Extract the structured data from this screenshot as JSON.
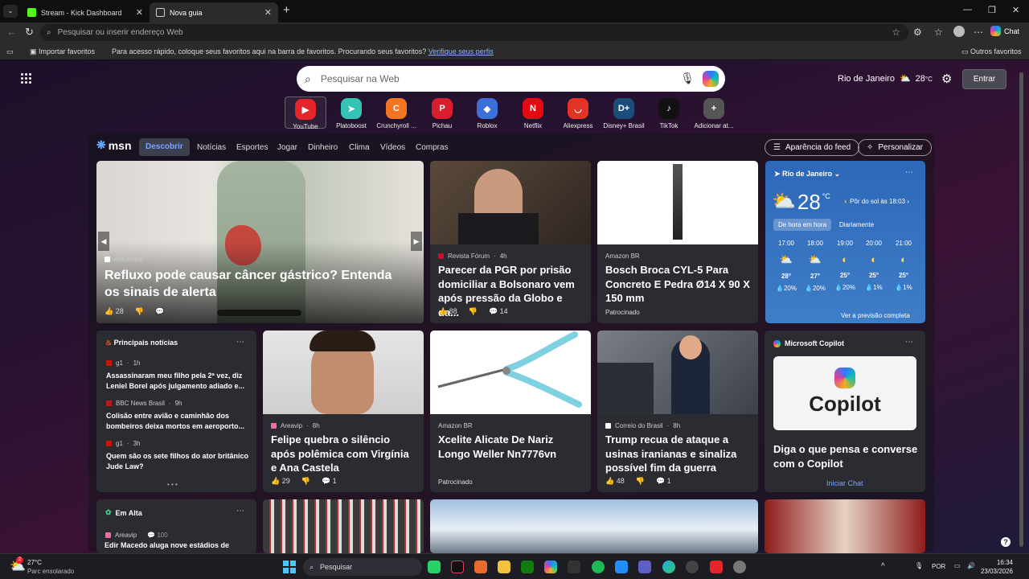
{
  "browser": {
    "tabs": [
      {
        "title": "Stream - Kick Dashboard",
        "active": false
      },
      {
        "title": "Nova guia",
        "active": true
      }
    ],
    "address_placeholder": "Pesquisar ou inserir endereço Web",
    "chat_label": "Chat",
    "bookmarks": {
      "import_label": "Importar favoritos",
      "hint_text": "Para acesso rápido, coloque seus favoritos aqui na barra de favoritos. Procurando seus favoritos?",
      "hint_link": "Verifique seus perfis",
      "other_favorites": "Outros favoritos"
    }
  },
  "ntp": {
    "search_placeholder": "Pesquisar na Web",
    "weather_location": "Rio de Janeiro",
    "weather_temp": "28",
    "weather_unit": "°C",
    "signin_label": "Entrar",
    "quick_links": [
      {
        "label": "YouTube",
        "color": "#e4252a",
        "glyph": "▶"
      },
      {
        "label": "Platoboost",
        "color": "#35c3b5",
        "glyph": "➤"
      },
      {
        "label": "Crunchyroll ...",
        "color": "#f47521",
        "glyph": "C"
      },
      {
        "label": "Pichau",
        "color": "#d81d2c",
        "glyph": "P"
      },
      {
        "label": "Roblox",
        "color": "#3d6fd8",
        "glyph": "◆"
      },
      {
        "label": "Netflix",
        "color": "#e50914",
        "glyph": "N"
      },
      {
        "label": "Aliexpress",
        "color": "#e43225",
        "glyph": "◡"
      },
      {
        "label": "Disney+ Brasil",
        "color": "#1a4d7a",
        "glyph": "D+"
      },
      {
        "label": "TikTok",
        "color": "#111111",
        "glyph": "♪"
      },
      {
        "label": "Adicionar at...",
        "color": "#555555",
        "glyph": "+"
      }
    ]
  },
  "msn": {
    "logo": "msn",
    "nav": [
      "Descobrir",
      "Notícias",
      "Esportes",
      "Jogar",
      "Dinheiro",
      "Clima",
      "Vídeos",
      "Compras"
    ],
    "feed_settings": "Aparência do feed",
    "personalize": "Personalizar",
    "hero": {
      "source": "Alto Astral",
      "headline": "Refluxo pode causar câncer gástrico? Entenda os sinais de alerta",
      "likes": "28"
    },
    "card_pgr": {
      "source": "Revista Fórum",
      "time": "4h",
      "headline": "Parecer da PGR por prisão domiciliar a Bolsonaro vem após pressão da Globo e da...",
      "likes": "88",
      "comments": "14"
    },
    "card_bosch": {
      "source": "Amazon BR",
      "headline": "Bosch Broca CYL-5 Para Concreto E Pedra Ø14 X 90 X 150 mm",
      "sponsored": "Patrocinado"
    },
    "weather": {
      "location": "Rio de Janeiro",
      "temp": "28",
      "unit": "°C",
      "sunset": "Pôr do sol às 18:03",
      "tab_hourly": "De hora em hora",
      "tab_daily": "Diariamente",
      "hours": [
        {
          "time": "17:00",
          "temp": "28°",
          "rain": "20%"
        },
        {
          "time": "18:00",
          "temp": "27°",
          "rain": "20%"
        },
        {
          "time": "19:00",
          "temp": "25°",
          "rain": "20%"
        },
        {
          "time": "20:00",
          "temp": "25°",
          "rain": "1%"
        },
        {
          "time": "21:00",
          "temp": "25°",
          "rain": "1%"
        }
      ],
      "full_forecast": "Ver a previsão completa"
    },
    "top_news": {
      "title": "Principais notícias",
      "items": [
        {
          "source": "g1",
          "time": "1h",
          "headline": "Assassinaram meu filho pela 2ª vez, diz Leniel Borel após julgamento adiado e..."
        },
        {
          "source": "BBC News Brasil",
          "time": "9h",
          "headline": "Colisão entre avião e caminhão dos bombeiros deixa mortos em aeroporto..."
        },
        {
          "source": "g1",
          "time": "3h",
          "headline": "Quem são os sete filhos do ator britânico Jude Law?"
        }
      ]
    },
    "card_felipe": {
      "source": "Areavip",
      "time": "8h",
      "headline": "Felipe quebra o silêncio após polêmica com Virgínia e Ana Castela",
      "likes": "29",
      "comments": "1"
    },
    "card_xcelite": {
      "source": "Amazon BR",
      "headline": "Xcelite Alicate De Nariz Longo Weller Nn7776vn",
      "sponsored": "Patrocinado"
    },
    "card_trump": {
      "source": "Correio do Brasil",
      "time": "8h",
      "headline": "Trump recua de ataque a usinas iranianas e sinaliza possível fim da guerra",
      "likes": "48",
      "comments": "1"
    },
    "copilot": {
      "title": "Microsoft Copilot",
      "logo_text": "Copilot",
      "headline": "Diga o que pensa e converse com o Copilot",
      "cta": "Iniciar Chat"
    },
    "trending": {
      "title": "Em Alta",
      "source": "Areavip",
      "count": "100",
      "headline": "Edir Macedo aluga nove estádios de"
    }
  },
  "taskbar": {
    "weather_temp": "27°C",
    "weather_desc": "Parc ensolarado",
    "badge": "2",
    "search_label": "Pesquisar",
    "lang": "POR",
    "time": "16:34",
    "date": "23/03/2026"
  }
}
